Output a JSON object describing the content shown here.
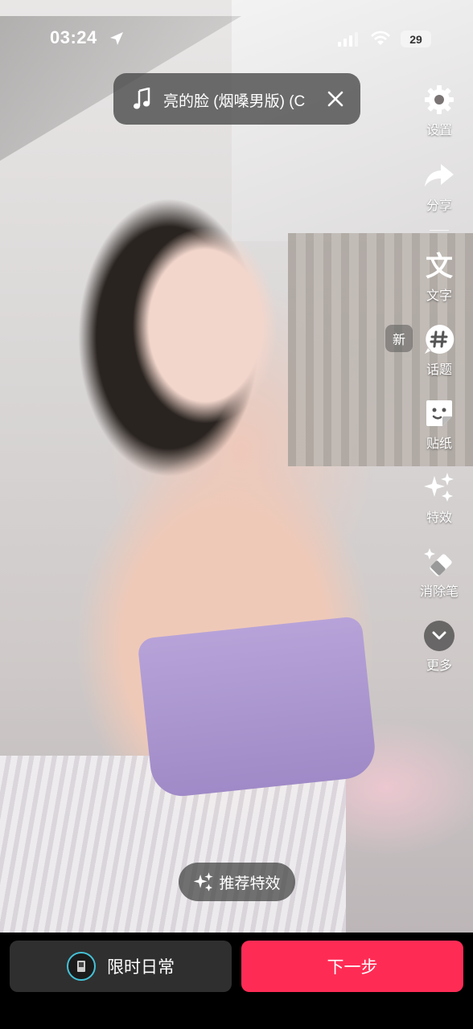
{
  "status_bar": {
    "time": "03:24",
    "battery": "29"
  },
  "music": {
    "title": "亮的脸 (烟嗓男版) (C"
  },
  "toolbar": {
    "settings": "设置",
    "share": "分享",
    "text": "文字",
    "new_badge": "新",
    "topic": "话题",
    "sticker": "贴纸",
    "effects": "特效",
    "eraser": "消除笔",
    "more": "更多"
  },
  "recommend": {
    "label": "推荐特效"
  },
  "bottom": {
    "daily_label": "限时日常",
    "next_label": "下一步"
  },
  "colors": {
    "accent": "#fe2c55",
    "secondary_button": "#2f2f2f"
  }
}
